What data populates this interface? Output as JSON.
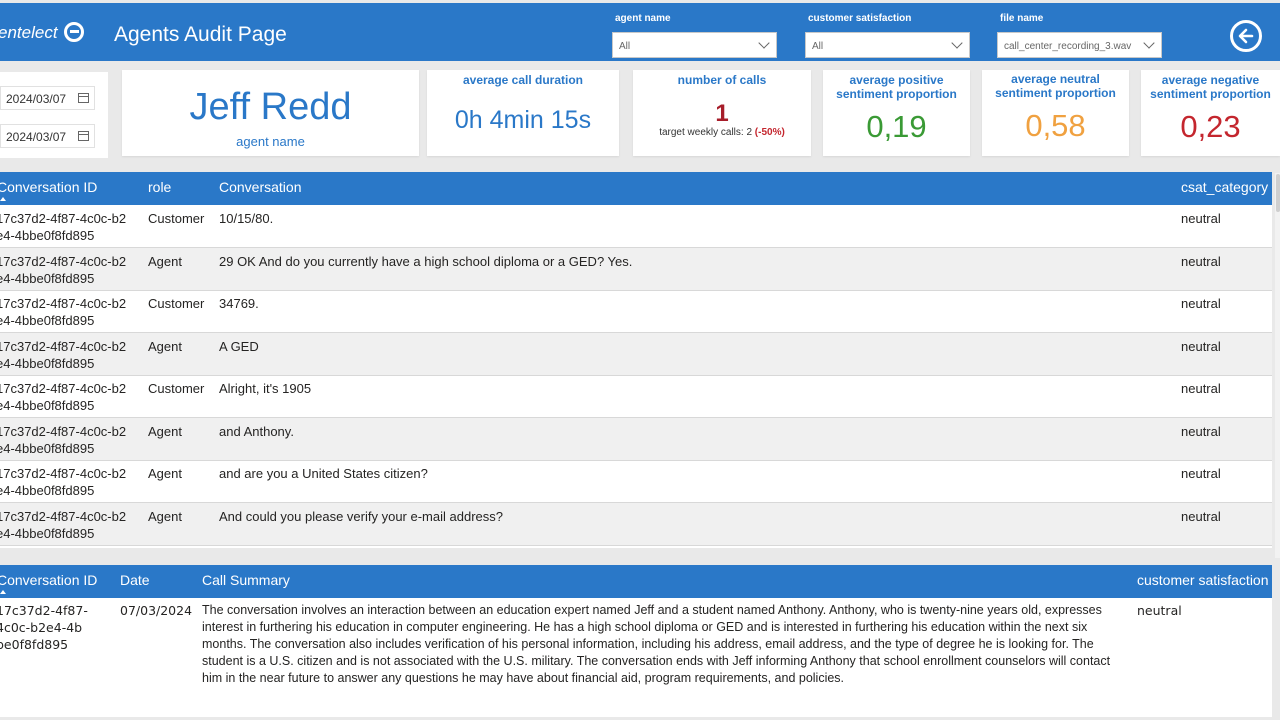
{
  "header": {
    "logo_text": "entelect",
    "title": "Agents Audit Page",
    "filters": [
      {
        "label": "agent name",
        "value": "All"
      },
      {
        "label": "customer satisfaction",
        "value": "All"
      },
      {
        "label": "file name",
        "value": "call_center_recording_3.wav"
      }
    ],
    "back_icon": "arrow-left-circle-icon"
  },
  "dates": {
    "start": "2024/03/07",
    "end": "2024/03/07"
  },
  "agent": {
    "name": "Jeff Redd",
    "label": "agent name"
  },
  "kpis": {
    "duration_title": "average call duration",
    "duration_value": "0h 4min 15s",
    "calls_title": "number of calls",
    "calls_value": "1",
    "calls_target_prefix": "target weekly calls: 2 ",
    "calls_target_delta": "(-50%)",
    "positive_title": "average positive sentiment proportion",
    "positive_value": "0,19",
    "positive_color": "#3a9a35",
    "neutral_title": "average neutral sentiment proportion",
    "neutral_value": "0,58",
    "neutral_color": "#f0a140",
    "negative_title": "average negative sentiment proportion",
    "negative_value": "0,23",
    "negative_color": "#c4262e"
  },
  "conversation_table": {
    "columns": [
      "Conversation ID",
      "role",
      "Conversation",
      "csat_category"
    ],
    "rows": [
      {
        "id": "17c37d2-4f87-4c0c-b2e4-4bbe0f8fd895",
        "role": "Customer",
        "text": "10/15/80.",
        "csat": "neutral"
      },
      {
        "id": "17c37d2-4f87-4c0c-b2e4-4bbe0f8fd895",
        "role": "Agent",
        "text": "29 OK And do you currently have a high school diploma or a GED? Yes.",
        "csat": "neutral"
      },
      {
        "id": "17c37d2-4f87-4c0c-b2e4-4bbe0f8fd895",
        "role": "Customer",
        "text": "34769.",
        "csat": "neutral"
      },
      {
        "id": "17c37d2-4f87-4c0c-b2e4-4bbe0f8fd895",
        "role": "Agent",
        "text": "A GED",
        "csat": "neutral"
      },
      {
        "id": "17c37d2-4f87-4c0c-b2e4-4bbe0f8fd895",
        "role": "Customer",
        "text": "Alright, it's 1905",
        "csat": "neutral"
      },
      {
        "id": "17c37d2-4f87-4c0c-b2e4-4bbe0f8fd895",
        "role": "Agent",
        "text": "and Anthony.",
        "csat": "neutral"
      },
      {
        "id": "17c37d2-4f87-4c0c-b2e4-4bbe0f8fd895",
        "role": "Agent",
        "text": "and are you a United States citizen?",
        "csat": "neutral"
      },
      {
        "id": "17c37d2-4f87-4c0c-b2e4-4bbe0f8fd895",
        "role": "Agent",
        "text": "And could you please verify your e-mail address?",
        "csat": "neutral"
      }
    ]
  },
  "summary_table": {
    "columns": [
      "Conversation ID",
      "Date",
      "Call Summary",
      "customer satisfaction"
    ],
    "row": {
      "id": "17c37d2-4f87-4c0c-b2e4-4bbe0f8fd895",
      "date": "07/03/2024",
      "summary": "The conversation involves an interaction between an education expert named Jeff and a student named Anthony. Anthony, who is twenty-nine years old, expresses interest in furthering his education in computer engineering. He has a high school diploma or GED and is interested in furthering his education within the next six months. The conversation also includes verification of his personal information, including his address, email address, and the type of degree he is looking for. The student is a U.S. citizen and is not associated with the U.S. military. The conversation ends with Jeff informing Anthony that school enrollment counselors will contact him in the near future to answer any questions he may have about financial aid, program requirements, and policies.",
      "satisfaction": "neutral"
    }
  }
}
